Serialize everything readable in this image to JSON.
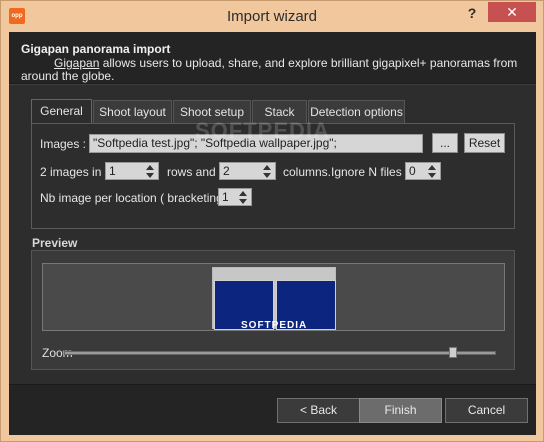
{
  "window": {
    "title": "Import wizard",
    "app_icon_text": "opp",
    "help_label": "?",
    "close_label": "✕"
  },
  "header": {
    "title": "Gigapan panorama import",
    "link": "Gigapan",
    "description": " allows users to upload, share, and explore brilliant gigapixel+ panoramas from around the globe."
  },
  "tabs": [
    {
      "label": "General",
      "active": true
    },
    {
      "label": "Shoot layout",
      "active": false
    },
    {
      "label": "Shoot setup",
      "active": false
    },
    {
      "label": "Stack",
      "active": false
    },
    {
      "label": "Detection options",
      "active": false
    }
  ],
  "general": {
    "images_label": "Images :",
    "images_value": "\"Softpedia test.jpg\"; \"Softpedia wallpaper.jpg\";",
    "browse_label": "...",
    "reset_label": "Reset",
    "images_in_label": "2 images in",
    "rows_value": "1",
    "rows_and_label": "rows and",
    "columns_value": "2",
    "columns_label": "columns.",
    "ignore_label": "Ignore N files",
    "ignore_value": "0",
    "bracketing_label": "Nb image per location ( bracketing )",
    "bracketing_value": "1"
  },
  "watermark": "SOFTPEDIA",
  "preview": {
    "label": "Preview",
    "tile_text": "SOFTPEDIA",
    "zoom_label": "Zoom",
    "zoom_level": 0.9
  },
  "footer": {
    "back_label": "< Back",
    "finish_label": "Finish",
    "cancel_label": "Cancel"
  }
}
